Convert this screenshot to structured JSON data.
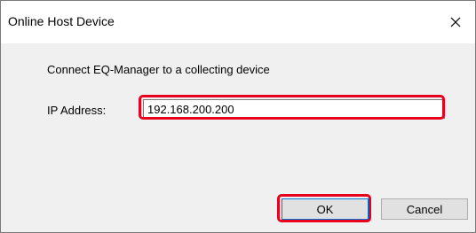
{
  "window": {
    "title": "Online Host Device",
    "close_icon": "close-icon"
  },
  "content": {
    "prompt": "Connect EQ-Manager to a collecting device",
    "ip_label": "IP Address:",
    "ip_value": "192.168.200.200"
  },
  "buttons": {
    "ok_label": "OK",
    "cancel_label": "Cancel"
  },
  "colors": {
    "highlight": "#e8001c",
    "focus_border": "#0078d7"
  }
}
